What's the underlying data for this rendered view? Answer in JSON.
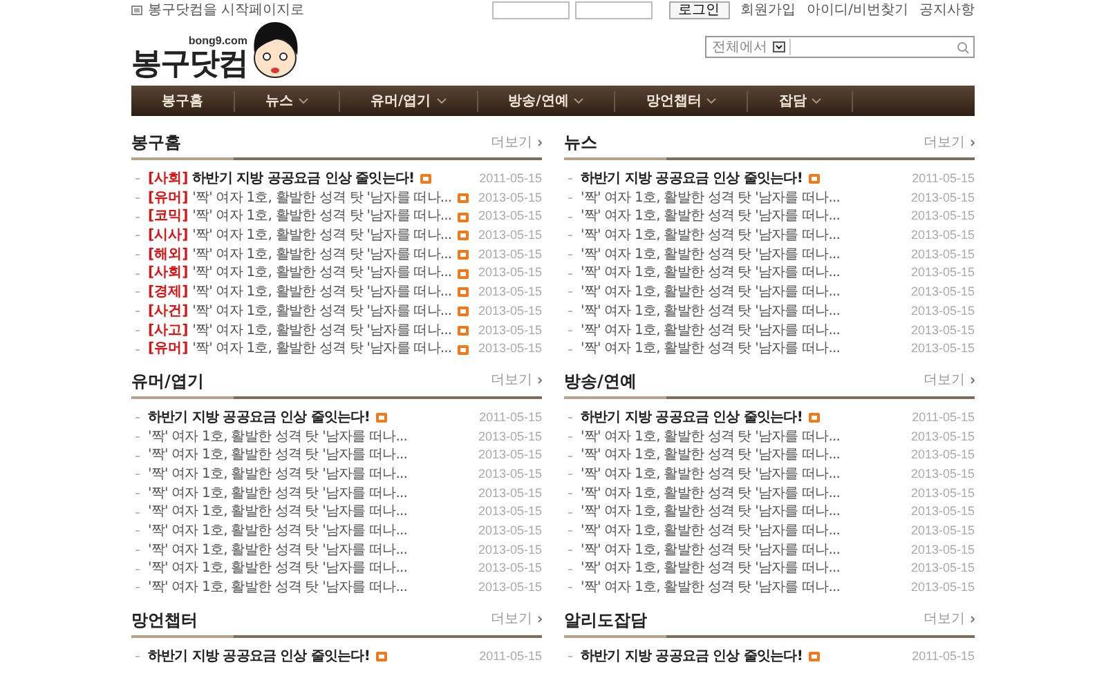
{
  "top_bar": {
    "start_page_link": "봉구닷컴을 시작페이지로",
    "login_button": "로그인",
    "links": [
      "회원가입",
      "아이디/비번찾기",
      "공지사항"
    ]
  },
  "logo": {
    "domain": "bong9.com",
    "name": "봉구닷컴"
  },
  "search": {
    "scope": "전체에서"
  },
  "nav": [
    {
      "label": "봉구홈",
      "dropdown": false
    },
    {
      "label": "뉴스",
      "dropdown": true
    },
    {
      "label": "유머/엽기",
      "dropdown": true
    },
    {
      "label": "방송/연예",
      "dropdown": true
    },
    {
      "label": "망언챕터",
      "dropdown": true
    },
    {
      "label": "잡담",
      "dropdown": true
    }
  ],
  "sections": [
    {
      "title": "봉구홈",
      "more": "더보기",
      "items": [
        {
          "tag": "[사회]",
          "title": "하반기 지방 공공요금 인상 줄잇는다!",
          "featured": true,
          "new": true,
          "date": "2011-05-15"
        },
        {
          "tag": "[유머]",
          "title": "'짝' 여자 1호, 활발한 성격 탓 '남자를 떠나...",
          "featured": false,
          "new": true,
          "date": "2013-05-15"
        },
        {
          "tag": "[코믹]",
          "title": "'짝' 여자 1호, 활발한 성격 탓 '남자를 떠나...",
          "featured": false,
          "new": true,
          "date": "2013-05-15"
        },
        {
          "tag": "[시사]",
          "title": "'짝' 여자 1호, 활발한 성격 탓 '남자를 떠나...",
          "featured": false,
          "new": true,
          "date": "2013-05-15"
        },
        {
          "tag": "[해외]",
          "title": "'짝' 여자 1호, 활발한 성격 탓 '남자를 떠나...",
          "featured": false,
          "new": true,
          "date": "2013-05-15"
        },
        {
          "tag": "[사회]",
          "title": "'짝' 여자 1호, 활발한 성격 탓 '남자를 떠나...",
          "featured": false,
          "new": true,
          "date": "2013-05-15"
        },
        {
          "tag": "[경제]",
          "title": "'짝' 여자 1호, 활발한 성격 탓 '남자를 떠나...",
          "featured": false,
          "new": true,
          "date": "2013-05-15"
        },
        {
          "tag": "[사건]",
          "title": "'짝' 여자 1호, 활발한 성격 탓 '남자를 떠나...",
          "featured": false,
          "new": true,
          "date": "2013-05-15"
        },
        {
          "tag": "[사고]",
          "title": "'짝' 여자 1호, 활발한 성격 탓 '남자를 떠나...",
          "featured": false,
          "new": true,
          "date": "2013-05-15"
        },
        {
          "tag": "[유머]",
          "title": "'짝' 여자 1호, 활발한 성격 탓 '남자를 떠나...",
          "featured": false,
          "new": true,
          "date": "2013-05-15"
        }
      ]
    },
    {
      "title": "뉴스",
      "more": "더보기",
      "items": [
        {
          "title": "하반기 지방 공공요금 인상 줄잇는다!",
          "featured": true,
          "new": true,
          "date": "2011-05-15"
        },
        {
          "title": "'짝' 여자 1호, 활발한 성격 탓 '남자를 떠나...",
          "featured": false,
          "new": false,
          "date": "2013-05-15"
        },
        {
          "title": "'짝' 여자 1호, 활발한 성격 탓 '남자를 떠나...",
          "featured": false,
          "new": false,
          "date": "2013-05-15"
        },
        {
          "title": "'짝' 여자 1호, 활발한 성격 탓 '남자를 떠나...",
          "featured": false,
          "new": false,
          "date": "2013-05-15"
        },
        {
          "title": "'짝' 여자 1호, 활발한 성격 탓 '남자를 떠나...",
          "featured": false,
          "new": false,
          "date": "2013-05-15"
        },
        {
          "title": "'짝' 여자 1호, 활발한 성격 탓 '남자를 떠나...",
          "featured": false,
          "new": false,
          "date": "2013-05-15"
        },
        {
          "title": "'짝' 여자 1호, 활발한 성격 탓 '남자를 떠나...",
          "featured": false,
          "new": false,
          "date": "2013-05-15"
        },
        {
          "title": "'짝' 여자 1호, 활발한 성격 탓 '남자를 떠나...",
          "featured": false,
          "new": false,
          "date": "2013-05-15"
        },
        {
          "title": "'짝' 여자 1호, 활발한 성격 탓 '남자를 떠나...",
          "featured": false,
          "new": false,
          "date": "2013-05-15"
        },
        {
          "title": "'짝' 여자 1호, 활발한 성격 탓 '남자를 떠나...",
          "featured": false,
          "new": false,
          "date": "2013-05-15"
        }
      ]
    },
    {
      "title": "유머/엽기",
      "more": "더보기",
      "items": [
        {
          "title": "하반기 지방 공공요금 인상 줄잇는다!",
          "featured": true,
          "new": true,
          "date": "2011-05-15"
        },
        {
          "title": "'짝' 여자 1호, 활발한 성격 탓 '남자를 떠나...",
          "featured": false,
          "new": false,
          "date": "2013-05-15"
        },
        {
          "title": "'짝' 여자 1호, 활발한 성격 탓 '남자를 떠나...",
          "featured": false,
          "new": false,
          "date": "2013-05-15"
        },
        {
          "title": "'짝' 여자 1호, 활발한 성격 탓 '남자를 떠나...",
          "featured": false,
          "new": false,
          "date": "2013-05-15"
        },
        {
          "title": "'짝' 여자 1호, 활발한 성격 탓 '남자를 떠나...",
          "featured": false,
          "new": false,
          "date": "2013-05-15"
        },
        {
          "title": "'짝' 여자 1호, 활발한 성격 탓 '남자를 떠나...",
          "featured": false,
          "new": false,
          "date": "2013-05-15"
        },
        {
          "title": "'짝' 여자 1호, 활발한 성격 탓 '남자를 떠나...",
          "featured": false,
          "new": false,
          "date": "2013-05-15"
        },
        {
          "title": "'짝' 여자 1호, 활발한 성격 탓 '남자를 떠나...",
          "featured": false,
          "new": false,
          "date": "2013-05-15"
        },
        {
          "title": "'짝' 여자 1호, 활발한 성격 탓 '남자를 떠나...",
          "featured": false,
          "new": false,
          "date": "2013-05-15"
        },
        {
          "title": "'짝' 여자 1호, 활발한 성격 탓 '남자를 떠나...",
          "featured": false,
          "new": false,
          "date": "2013-05-15"
        }
      ]
    },
    {
      "title": "방송/연예",
      "more": "더보기",
      "items": [
        {
          "title": "하반기 지방 공공요금 인상 줄잇는다!",
          "featured": true,
          "new": true,
          "date": "2011-05-15"
        },
        {
          "title": "'짝' 여자 1호, 활발한 성격 탓 '남자를 떠나...",
          "featured": false,
          "new": false,
          "date": "2013-05-15"
        },
        {
          "title": "'짝' 여자 1호, 활발한 성격 탓 '남자를 떠나...",
          "featured": false,
          "new": false,
          "date": "2013-05-15"
        },
        {
          "title": "'짝' 여자 1호, 활발한 성격 탓 '남자를 떠나...",
          "featured": false,
          "new": false,
          "date": "2013-05-15"
        },
        {
          "title": "'짝' 여자 1호, 활발한 성격 탓 '남자를 떠나...",
          "featured": false,
          "new": false,
          "date": "2013-05-15"
        },
        {
          "title": "'짝' 여자 1호, 활발한 성격 탓 '남자를 떠나...",
          "featured": false,
          "new": false,
          "date": "2013-05-15"
        },
        {
          "title": "'짝' 여자 1호, 활발한 성격 탓 '남자를 떠나...",
          "featured": false,
          "new": false,
          "date": "2013-05-15"
        },
        {
          "title": "'짝' 여자 1호, 활발한 성격 탓 '남자를 떠나...",
          "featured": false,
          "new": false,
          "date": "2013-05-15"
        },
        {
          "title": "'짝' 여자 1호, 활발한 성격 탓 '남자를 떠나...",
          "featured": false,
          "new": false,
          "date": "2013-05-15"
        },
        {
          "title": "'짝' 여자 1호, 활발한 성격 탓 '남자를 떠나...",
          "featured": false,
          "new": false,
          "date": "2013-05-15"
        }
      ]
    },
    {
      "title": "망언챕터",
      "more": "더보기",
      "items": [
        {
          "title": "하반기 지방 공공요금 인상 줄잇는다!",
          "featured": true,
          "new": true,
          "date": "2011-05-15"
        }
      ]
    },
    {
      "title": "알리도잡담",
      "more": "더보기",
      "items": [
        {
          "title": "하반기 지방 공공요금 인상 줄잇는다!",
          "featured": true,
          "new": true,
          "date": "2011-05-15"
        }
      ]
    }
  ]
}
